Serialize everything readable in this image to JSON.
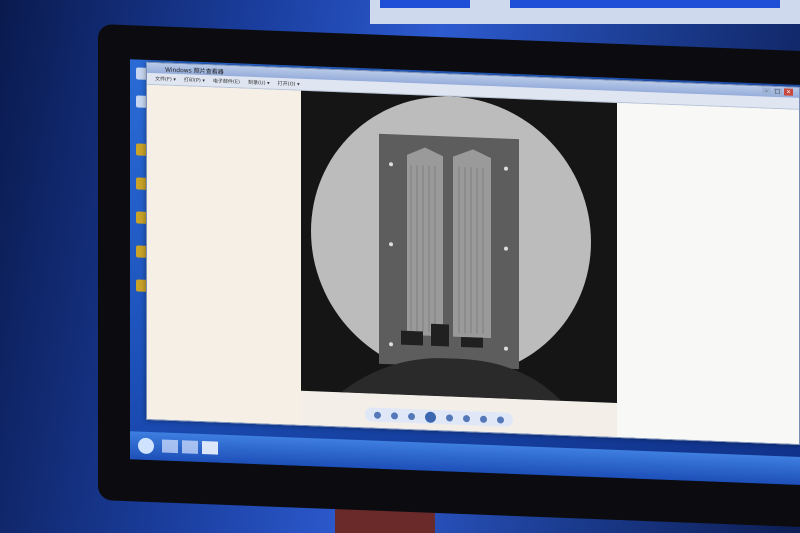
{
  "window": {
    "title": "Windows 照片查看器",
    "controls": {
      "minimize": "–",
      "maximize": "□",
      "close": "×"
    }
  },
  "menu": {
    "items": [
      "文件(F) ▾",
      "打印(P) ▾",
      "电子邮件(E)",
      "刻录(U) ▾",
      "打开(O) ▾"
    ]
  },
  "desktop": {
    "icon_names": [
      "computer-icon",
      "recycle-bin-icon",
      "folder-icon",
      "folder-icon",
      "folder-icon",
      "folder-icon",
      "folder-icon"
    ]
  },
  "viewer": {
    "toolbar_buttons": [
      "zoom-icon",
      "fit-icon",
      "previous-icon",
      "slideshow-icon",
      "next-icon",
      "rotate-left-icon",
      "rotate-right-icon",
      "delete-icon"
    ]
  },
  "taskbar": {
    "clock": ""
  },
  "colors": {
    "accent": "#2d5bd0",
    "xray_bg": "#151515"
  }
}
